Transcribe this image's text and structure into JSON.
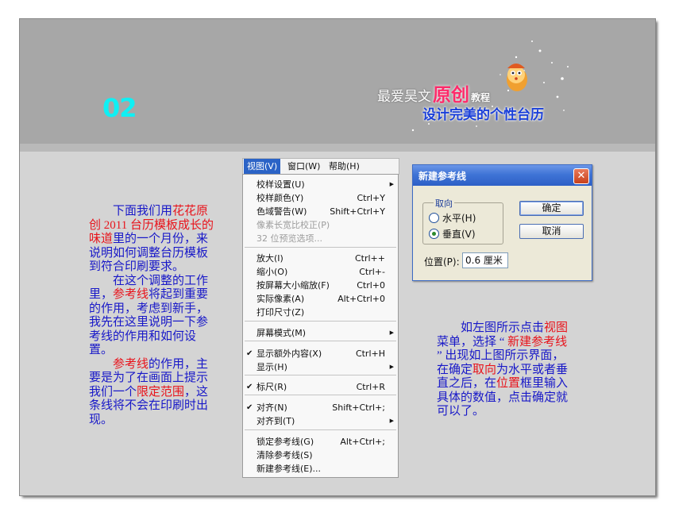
{
  "banner": {
    "step_number": "02",
    "brand_part1": "最爱昊文",
    "brand_part2": "原创",
    "brand_part3": "教程",
    "subtitle": "设计完美的个性台历",
    "colors": {
      "banner": "#a7a7a7",
      "step": "#0ff0f4",
      "subtitle": "#1a3fd8",
      "accent": "#ff2a6a"
    }
  },
  "left_text": {
    "p1": [
      {
        "t": "下面我们用",
        "hl": false
      },
      {
        "t": "花花原创 2011 台历模板成长的味道",
        "hl": true
      },
      {
        "t": "里的一个月份，来说明如何调整台历模板到符合印刷要求。",
        "hl": false
      }
    ],
    "p2": [
      {
        "t": "在这个调整的工作里，",
        "hl": false
      },
      {
        "t": "参考线",
        "hl": true
      },
      {
        "t": "将起到重要的作用，考虑到新手，我先在这里说明一下参考线的作用和如何设置。",
        "hl": false
      }
    ],
    "p3": [
      {
        "t": "参考线",
        "hl": true
      },
      {
        "t": "的作用，主要是为了在画面上提示我们一个",
        "hl": false
      },
      {
        "t": "限定范围",
        "hl": true
      },
      {
        "t": "，这条线将不会在印刷时出现。",
        "hl": false
      }
    ]
  },
  "right_text": {
    "p1": [
      {
        "t": "如左图所示点击",
        "hl": false
      },
      {
        "t": "视图",
        "hl": true
      },
      {
        "t": "菜单，选择 “ ",
        "hl": false
      },
      {
        "t": "新建参考线",
        "hl": true
      },
      {
        "t": " ” 出现如上图所示界面，在确定",
        "hl": false
      },
      {
        "t": "取向",
        "hl": true
      },
      {
        "t": "为水平或者垂直之后，在",
        "hl": false
      },
      {
        "t": "位置",
        "hl": true
      },
      {
        "t": "框里输入具体的数值，点击确定就可以了。",
        "hl": false
      }
    ]
  },
  "menubar": {
    "view": "视图(V)",
    "window": "窗口(W)",
    "help": "帮助(H)"
  },
  "menu": {
    "items": [
      {
        "label": "校样设置(U)",
        "shortcut": "",
        "submenu": true,
        "check": false,
        "disabled": false
      },
      {
        "label": "校样颜色(Y)",
        "shortcut": "Ctrl+Y",
        "submenu": false,
        "check": false,
        "disabled": false
      },
      {
        "label": "色域警告(W)",
        "shortcut": "Shift+Ctrl+Y",
        "submenu": false,
        "check": false,
        "disabled": false
      },
      {
        "label": "像素长宽比校正(P)",
        "shortcut": "",
        "submenu": false,
        "check": false,
        "disabled": true
      },
      {
        "label": "32 位预览选项...",
        "shortcut": "",
        "submenu": false,
        "check": false,
        "disabled": true
      },
      {
        "label": "放大(I)",
        "shortcut": "Ctrl++",
        "submenu": false,
        "check": false,
        "disabled": false
      },
      {
        "label": "缩小(O)",
        "shortcut": "Ctrl+-",
        "submenu": false,
        "check": false,
        "disabled": false
      },
      {
        "label": "按屏幕大小缩放(F)",
        "shortcut": "Ctrl+0",
        "submenu": false,
        "check": false,
        "disabled": false
      },
      {
        "label": "实际像素(A)",
        "shortcut": "Alt+Ctrl+0",
        "submenu": false,
        "check": false,
        "disabled": false
      },
      {
        "label": "打印尺寸(Z)",
        "shortcut": "",
        "submenu": false,
        "check": false,
        "disabled": false
      },
      {
        "label": "屏幕模式(M)",
        "shortcut": "",
        "submenu": true,
        "check": false,
        "disabled": false
      },
      {
        "label": "显示额外内容(X)",
        "shortcut": "Ctrl+H",
        "submenu": false,
        "check": true,
        "disabled": false
      },
      {
        "label": "显示(H)",
        "shortcut": "",
        "submenu": true,
        "check": false,
        "disabled": false
      },
      {
        "label": "标尺(R)",
        "shortcut": "Ctrl+R",
        "submenu": false,
        "check": true,
        "disabled": false
      },
      {
        "label": "对齐(N)",
        "shortcut": "Shift+Ctrl+;",
        "submenu": false,
        "check": true,
        "disabled": false
      },
      {
        "label": "对齐到(T)",
        "shortcut": "",
        "submenu": true,
        "check": false,
        "disabled": false
      },
      {
        "label": "锁定参考线(G)",
        "shortcut": "Alt+Ctrl+;",
        "submenu": false,
        "check": false,
        "disabled": false
      },
      {
        "label": "清除参考线(S)",
        "shortcut": "",
        "submenu": false,
        "check": false,
        "disabled": false
      },
      {
        "label": "新建参考线(E)...",
        "shortcut": "",
        "submenu": false,
        "check": false,
        "disabled": false
      }
    ]
  },
  "dialog": {
    "title": "新建参考线",
    "close_symbol": "✕",
    "orientation_label": "取向",
    "horizontal": "水平(H)",
    "vertical": "垂直(V)",
    "selected": "vertical",
    "ok": "确定",
    "cancel": "取消",
    "position_label": "位置(P):",
    "position_value": "0.6 厘米"
  }
}
